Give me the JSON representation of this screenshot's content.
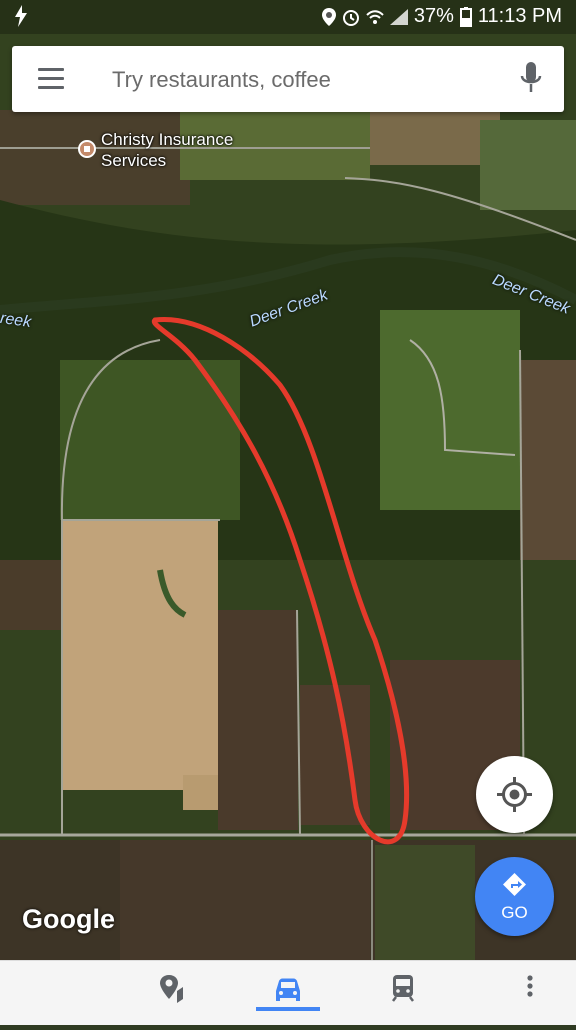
{
  "status_bar": {
    "battery": "37%",
    "time": "11:13 PM"
  },
  "search": {
    "placeholder": "Try restaurants, coffee"
  },
  "map": {
    "poi_label_line1": "Christy Insurance",
    "poi_label_line2": "Services",
    "creek_labels": [
      "reek",
      "Deer Creek",
      "Deer Creek"
    ],
    "attribution": "Google"
  },
  "go_button": {
    "label": "GO"
  },
  "bottom_nav": {
    "items": [
      "explore-pin",
      "driving",
      "transit",
      "more"
    ],
    "active": "driving"
  },
  "colors": {
    "accent_blue": "#4285f4",
    "annotation_red": "#e53a2b"
  }
}
